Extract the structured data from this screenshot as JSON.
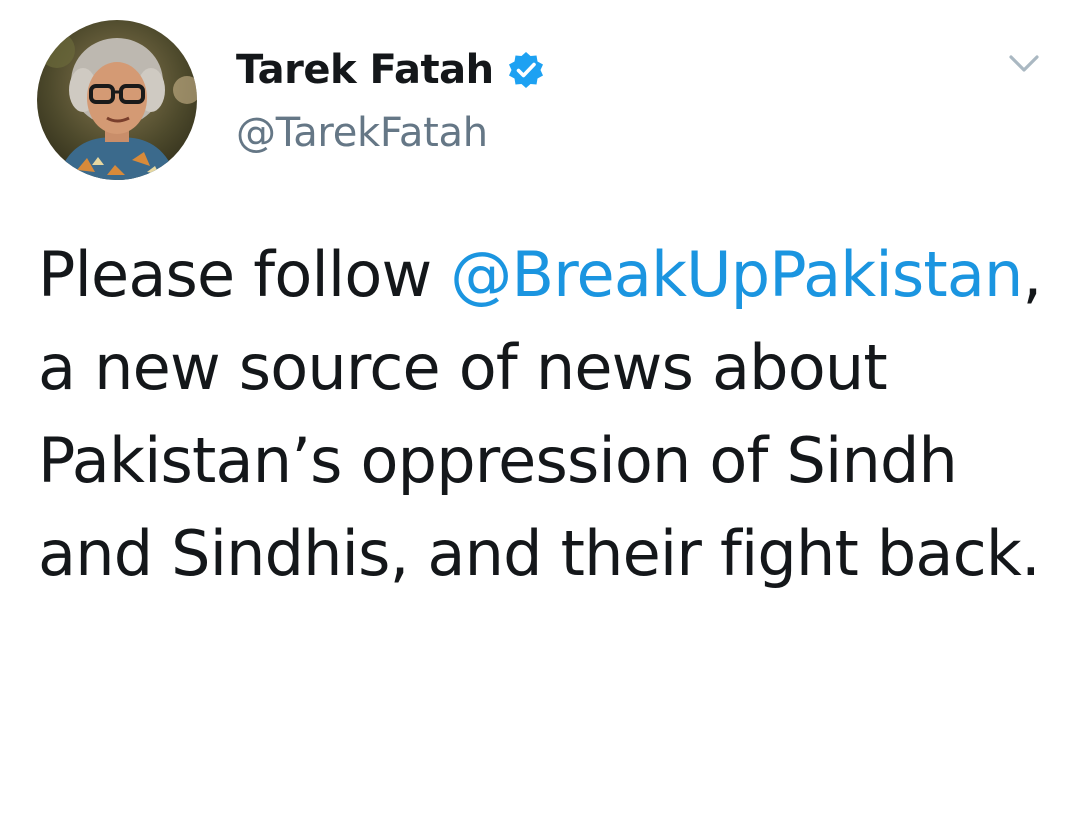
{
  "author": {
    "display_name": "Tarek Fatah",
    "handle": "@TarekFatah",
    "verified": true,
    "avatar": "profile-photo"
  },
  "menu": {
    "icon": "chevron-down-icon"
  },
  "tweet": {
    "text_before": "Please follow ",
    "mention": "@BreakUpPakistan",
    "text_after": ", a new source of news about Pakistan’s oppression of Sindh and Sindhis, and their fight back."
  },
  "colors": {
    "link": "#1b95e0",
    "verified_badge": "#1da1f2",
    "handle": "#657786",
    "text": "#14171a"
  }
}
